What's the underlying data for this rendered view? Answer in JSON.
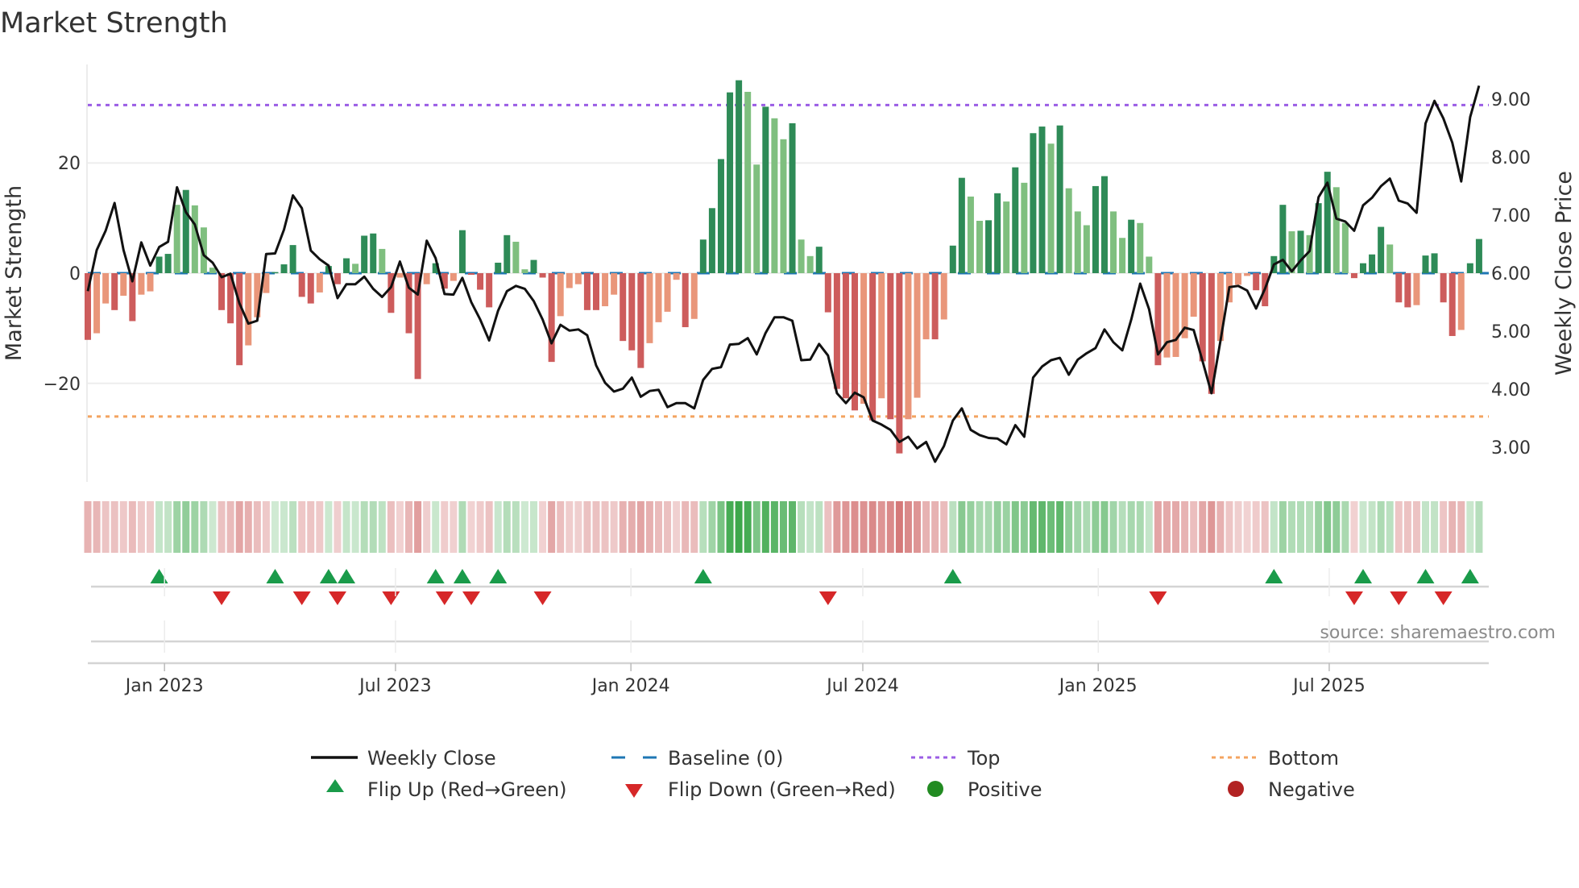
{
  "chart_data": {
    "type": "bar",
    "title": "Market Strength",
    "ylabel": "Market Strength",
    "y2label": "Weekly Close Price",
    "ylim": [
      -30,
      32
    ],
    "y2lim": [
      2.58,
      9.74
    ],
    "yticks": [
      {
        "value": 20,
        "label": "20"
      },
      {
        "value": 0,
        "label": "0"
      },
      {
        "value": -20,
        "label": "−20"
      }
    ],
    "y2ticks": [
      {
        "value": 9,
        "label": "9.00"
      },
      {
        "value": 8,
        "label": "8.00"
      },
      {
        "value": 7,
        "label": "7.00"
      },
      {
        "value": 6,
        "label": "6.00"
      },
      {
        "value": 5,
        "label": "5.00"
      },
      {
        "value": 4,
        "label": "4.00"
      },
      {
        "value": 3,
        "label": "3.00"
      }
    ],
    "x_ticks": [
      {
        "label": "Jan 2023",
        "week": 8.6
      },
      {
        "label": "Jul 2023",
        "week": 34.5
      },
      {
        "label": "Jan 2024",
        "week": 60.9
      },
      {
        "label": "Jul 2024",
        "week": 86.9
      },
      {
        "label": "Jan 2025",
        "week": 113.3
      },
      {
        "label": "Jul 2025",
        "week": 139.2
      }
    ],
    "top_level": 30.5,
    "bottom_level": -26,
    "baseline": 0,
    "strength": [
      -12.1,
      -10.9,
      -5.5,
      -6.7,
      -4.1,
      -8.7,
      -3.9,
      -3.3,
      3.0,
      3.5,
      12.4,
      15.1,
      12.3,
      8.3,
      1.0,
      -6.7,
      -9.1,
      -16.7,
      -13.1,
      -8.0,
      -3.6,
      0.2,
      1.6,
      5.1,
      -4.3,
      -5.5,
      -3.5,
      1.3,
      -2.0,
      2.7,
      1.7,
      6.8,
      7.2,
      4.4,
      -7.2,
      -0.8,
      -10.9,
      -19.2,
      -2.0,
      1.8,
      -2.8,
      -1.4,
      7.8,
      -0.3,
      -3.0,
      -6.2,
      1.9,
      6.9,
      5.7,
      0.7,
      2.4,
      -0.8,
      -16.1,
      -7.8,
      -2.7,
      -2.0,
      -6.7,
      -6.7,
      -6.0,
      -3.9,
      -12.3,
      -14.0,
      -17.2,
      -12.7,
      -8.9,
      -7.0,
      -1.2,
      -9.8,
      -8.3,
      6.1,
      11.8,
      20.7,
      32.8,
      35.0,
      32.9,
      19.7,
      30.2,
      28.1,
      24.3,
      27.2,
      6.1,
      3.1,
      4.8,
      -7.1,
      -21.0,
      -22.7,
      -24.9,
      -23.7,
      -26.7,
      -22.7,
      -26.5,
      -32.7,
      -26.5,
      -22.6,
      -12.0,
      -12.0,
      -8.4,
      5.0,
      17.3,
      13.9,
      9.5,
      9.6,
      14.5,
      13.0,
      19.2,
      16.4,
      25.4,
      26.6,
      23.5,
      26.8,
      15.4,
      11.2,
      8.7,
      15.8,
      17.6,
      11.2,
      6.4,
      9.7,
      9.1,
      3.0,
      -16.7,
      -15.3,
      -15.2,
      -11.8,
      -7.9,
      -16.0,
      -21.9,
      -12.3,
      -5.3,
      -2.1,
      -0.5,
      -3.1,
      -6.0,
      3.1,
      12.4,
      7.6,
      7.7,
      6.9,
      12.7,
      18.4,
      15.6,
      9.1,
      -0.9,
      1.8,
      3.4,
      8.4,
      5.2,
      -5.3,
      -6.2,
      -5.8,
      3.2,
      3.6,
      -5.3,
      -11.4,
      -10.3,
      1.8,
      6.2
    ],
    "strength_tone": "DLLDLDLLDDLDLLLDDDLLLDDDDDLDDDLDDLDLDDLDDLDDDDDDLLDDDLLLDDLLDDDLLLLDLDDDDDLLDLLDLLDDDDDLDLDDLLLDLDDLLDDLDLDDLDLLLDDLLDLLDLLLLDDLLLLDDDDLDLDDLLDDDDLDDLDDDDLDD",
    "weekly_close": [
      5.69,
      6.4,
      6.73,
      7.21,
      6.4,
      5.86,
      6.53,
      6.13,
      6.45,
      6.54,
      7.48,
      7.05,
      6.84,
      6.31,
      6.18,
      5.93,
      5.99,
      5.48,
      5.13,
      5.18,
      6.33,
      6.34,
      6.75,
      7.34,
      7.12,
      6.39,
      6.24,
      6.13,
      5.57,
      5.81,
      5.81,
      5.94,
      5.73,
      5.59,
      5.76,
      6.2,
      5.75,
      5.63,
      6.56,
      6.26,
      5.64,
      5.63,
      5.92,
      5.5,
      5.2,
      4.84,
      5.35,
      5.69,
      5.78,
      5.73,
      5.52,
      5.2,
      4.79,
      5.11,
      5.01,
      5.03,
      4.93,
      4.41,
      4.11,
      3.96,
      4.01,
      4.2,
      3.87,
      3.97,
      3.99,
      3.69,
      3.76,
      3.76,
      3.67,
      4.16,
      4.35,
      4.38,
      4.77,
      4.78,
      4.88,
      4.6,
      4.97,
      5.24,
      5.24,
      5.18,
      4.5,
      4.51,
      4.78,
      4.58,
      3.93,
      3.76,
      3.94,
      3.86,
      3.46,
      3.39,
      3.3,
      3.09,
      3.18,
      2.98,
      3.09,
      2.75,
      3.02,
      3.46,
      3.67,
      3.3,
      3.21,
      3.16,
      3.15,
      3.05,
      3.38,
      3.18,
      4.2,
      4.39,
      4.5,
      4.54,
      4.25,
      4.51,
      4.62,
      4.71,
      5.03,
      4.81,
      4.67,
      5.2,
      5.82,
      5.38,
      4.6,
      4.81,
      4.85,
      5.06,
      5.02,
      4.48,
      3.93,
      4.83,
      5.76,
      5.78,
      5.7,
      5.39,
      5.73,
      6.15,
      6.23,
      6.03,
      6.22,
      6.38,
      7.31,
      7.56,
      6.94,
      6.89,
      6.73,
      7.17,
      7.3,
      7.5,
      7.63,
      7.25,
      7.2,
      7.04,
      8.58,
      8.97,
      8.67,
      8.25,
      7.58,
      8.69,
      9.23
    ],
    "legend": {
      "placement": "bottom",
      "items": [
        {
          "label": "Weekly Close",
          "symbol": "line"
        },
        {
          "label": "Baseline (0)",
          "symbol": "dashed"
        },
        {
          "label": "Top",
          "symbol": "dotted-purple"
        },
        {
          "label": "Bottom",
          "symbol": "dotted-orange"
        },
        {
          "label": "Flip Up (Red→Green)",
          "symbol": "triangle-up"
        },
        {
          "label": "Flip Down (Green→Red)",
          "symbol": "triangle-down"
        },
        {
          "label": "Positive",
          "symbol": "circle-green"
        },
        {
          "label": "Negative",
          "symbol": "circle-red"
        }
      ]
    },
    "source": "source: sharemaestro.com",
    "colors": {
      "green_dark": "#2e8b57",
      "green_light": "#7fbf7f",
      "red_dark": "#cd5c5c",
      "red_light": "#e9967a",
      "close": "#111111",
      "baseline": "#1f77b4",
      "top": "#9b5de5",
      "bottom": "#f4a460",
      "flip_up": "#1a9b4a",
      "flip_down": "#d62728",
      "positive": "#228b22",
      "negative": "#b22222"
    }
  }
}
